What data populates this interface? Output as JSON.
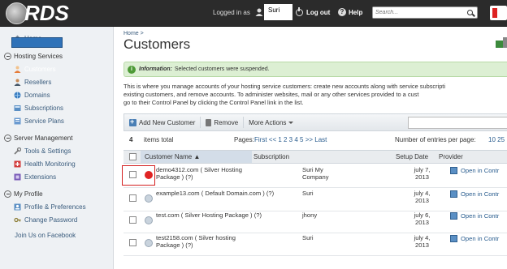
{
  "header": {
    "logo_text": "RDS",
    "logged_in_label": "Logged in as",
    "username": "Suri",
    "logout_label": "Log out",
    "help_label": "Help",
    "search_placeholder": "Search..."
  },
  "sidebar": {
    "home": "Home",
    "sections": [
      {
        "title": "Hosting Services",
        "items": [
          "Customers",
          "Resellers",
          "Domains",
          "Subscriptions",
          "Service Plans"
        ]
      },
      {
        "title": "Server Management",
        "items": [
          "Tools & Settings",
          "Health Monitoring",
          "Extensions"
        ]
      },
      {
        "title": "My Profile",
        "items": [
          "Profile & Preferences",
          "Change Password"
        ]
      }
    ],
    "active_item": "Customers",
    "footer_link": "Join Us on Facebook"
  },
  "main": {
    "breadcrumb": "Home >",
    "title": "Customers",
    "info_label": "Information:",
    "info_text": "Selected customers were suspended.",
    "description_line1": "This is where you manage accounts of your hosting service customers: create new accounts along with service subscripti",
    "description_line2": "existing customers, and remove accounts. To administer websites, mail or any other services provided to a cust",
    "description_line3": "go to their Control Panel by clicking the Control Panel link in the list.",
    "toolbar": {
      "add_label": "Add New Customer",
      "remove_label": "Remove",
      "more_label": "More Actions"
    },
    "pager": {
      "count": "4",
      "total_label": "items total",
      "pages_label": "Pages:",
      "pages_links": "First << 1 2 3 4 5 >> Last",
      "perpage_label": "Number of entries per page:",
      "perpage_options": "10 25"
    },
    "table": {
      "columns": [
        "Customer Name",
        "Subscription",
        "Setup Date",
        "Provider"
      ],
      "rows": [
        {
          "name_line1": "demo4312.com ( Silver Hosting",
          "name_line2": "Package ) (?)",
          "sub_line1": "Suri  My",
          "sub_line2": "Company",
          "date_line1": "july 7,",
          "date_line2": "2013",
          "provider": "Open in Contr",
          "status_color": "#e02424"
        },
        {
          "name_line1": "example13.com ( Default Domain.com ) (?)",
          "name_line2": "",
          "sub_line1": "Suri",
          "sub_line2": "",
          "date_line1": "july 4,",
          "date_line2": "2013",
          "provider": "Open in Contr",
          "status_color": "#c9d3dd"
        },
        {
          "name_line1": "test.com ( Silver Hosting Package ) (?)",
          "name_line2": "",
          "sub_line1": "jhony",
          "sub_line2": "",
          "date_line1": "july 6,",
          "date_line2": "2013",
          "provider": "Open in Contr",
          "status_color": "#c9d3dd"
        },
        {
          "name_line1": "test2158.com ( Silver hosting",
          "name_line2": "Package ) (?)",
          "sub_line1": "Suri",
          "sub_line2": "",
          "date_line1": "july 4,",
          "date_line2": "2013",
          "provider": "Open in Contr",
          "status_color": "#c9d3dd"
        }
      ]
    }
  }
}
